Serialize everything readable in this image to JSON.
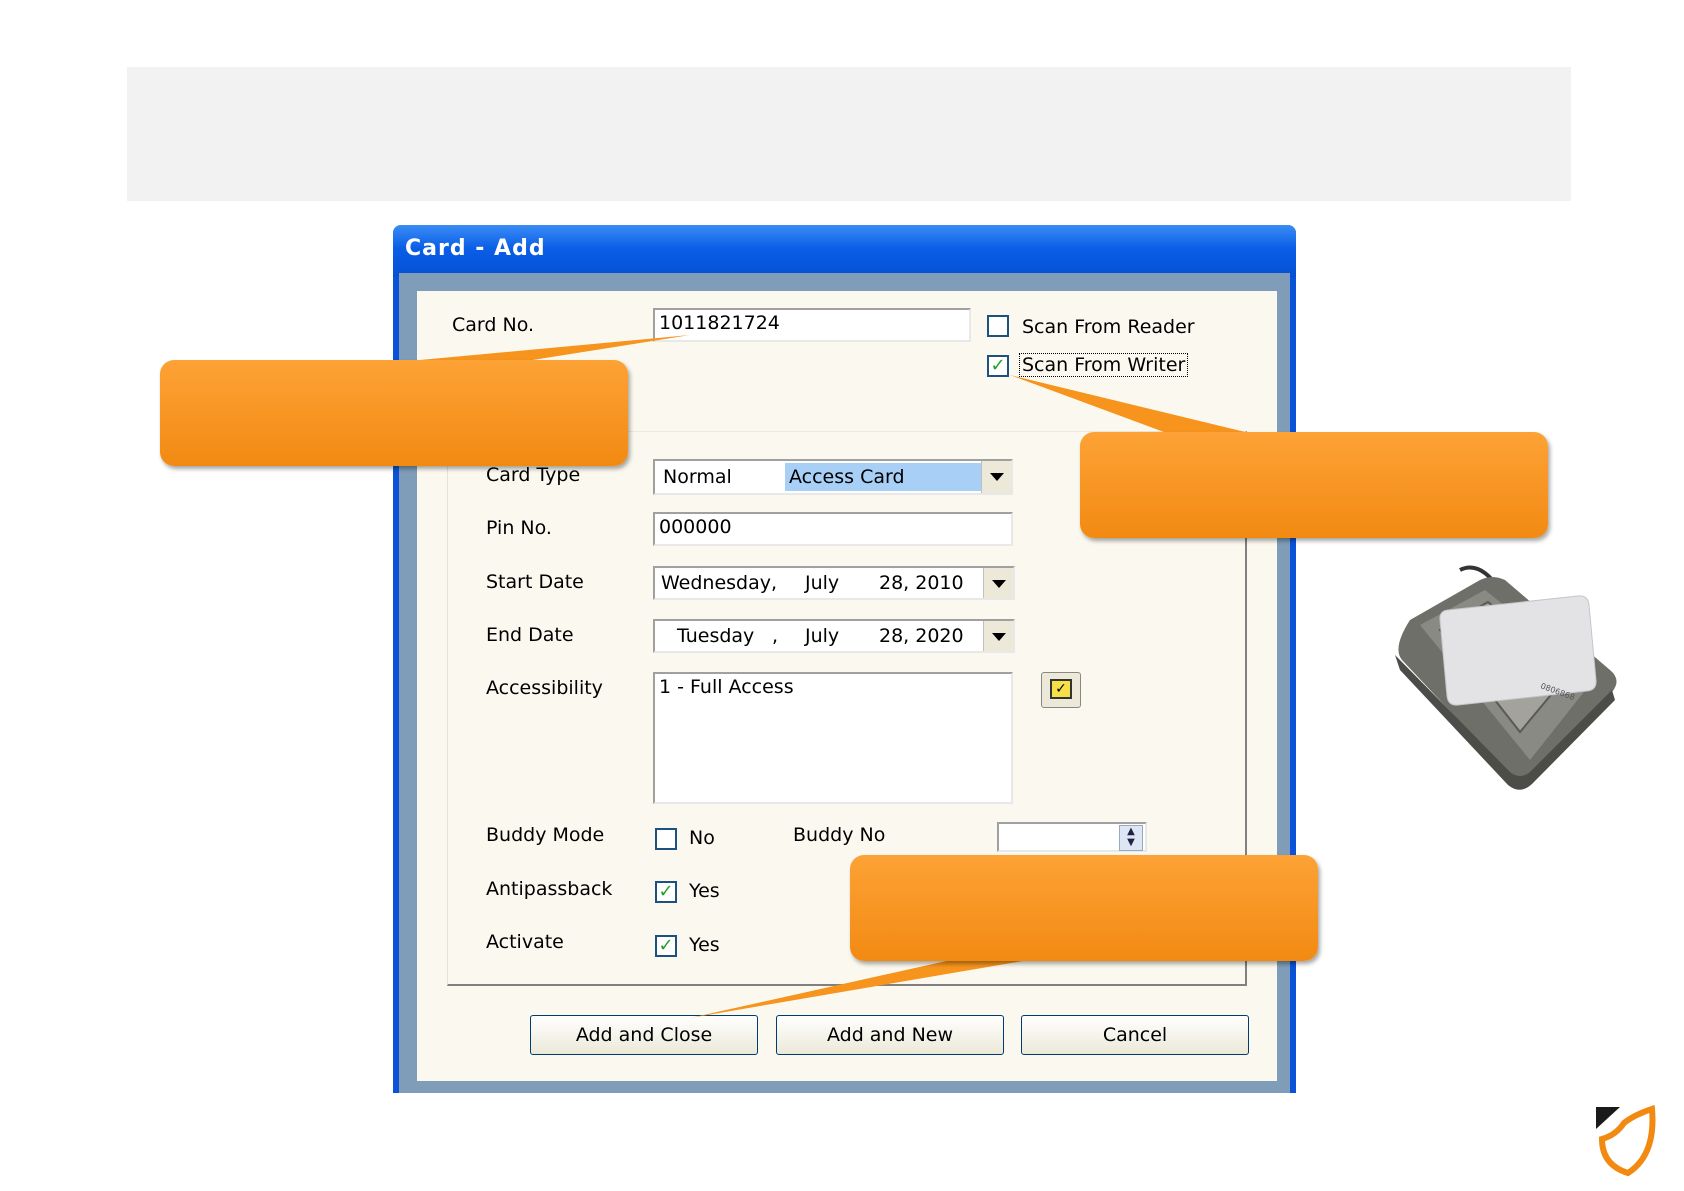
{
  "dialog": {
    "title": "Card - Add",
    "card_no_label": "Card No.",
    "card_no_value": "1011821724",
    "scan_reader_label": "Scan From Reader",
    "scan_reader_checked": false,
    "scan_writer_label": "Scan From Writer",
    "scan_writer_checked": true,
    "card_type_label": "Card Type",
    "card_type_value_1": "Normal",
    "card_type_value_2": "Access Card",
    "pin_label": "Pin No.",
    "pin_value": "000000",
    "start_label": "Start Date",
    "start_day": "Wednesday,",
    "start_month": "July",
    "start_date": "28, 2010",
    "end_label": "End Date",
    "end_day": "Tuesday",
    "end_comma": ",",
    "end_month": "July",
    "end_date": "28, 2020",
    "access_label": "Accessibility",
    "access_value": "1 - Full Access",
    "buddy_mode_label": "Buddy Mode",
    "buddy_mode_option": "No",
    "buddy_no_label": "Buddy No",
    "antipassback_label": "Antipassback",
    "antipassback_option": "Yes",
    "activate_label": "Activate",
    "activate_option": "Yes",
    "btn_add_close": "Add and Close",
    "btn_add_new": "Add and New",
    "btn_cancel": "Cancel"
  },
  "colors": {
    "callout": "#f7941d",
    "titlebar": "#0a52d8",
    "card_type_highlight": "#a8cff5"
  }
}
